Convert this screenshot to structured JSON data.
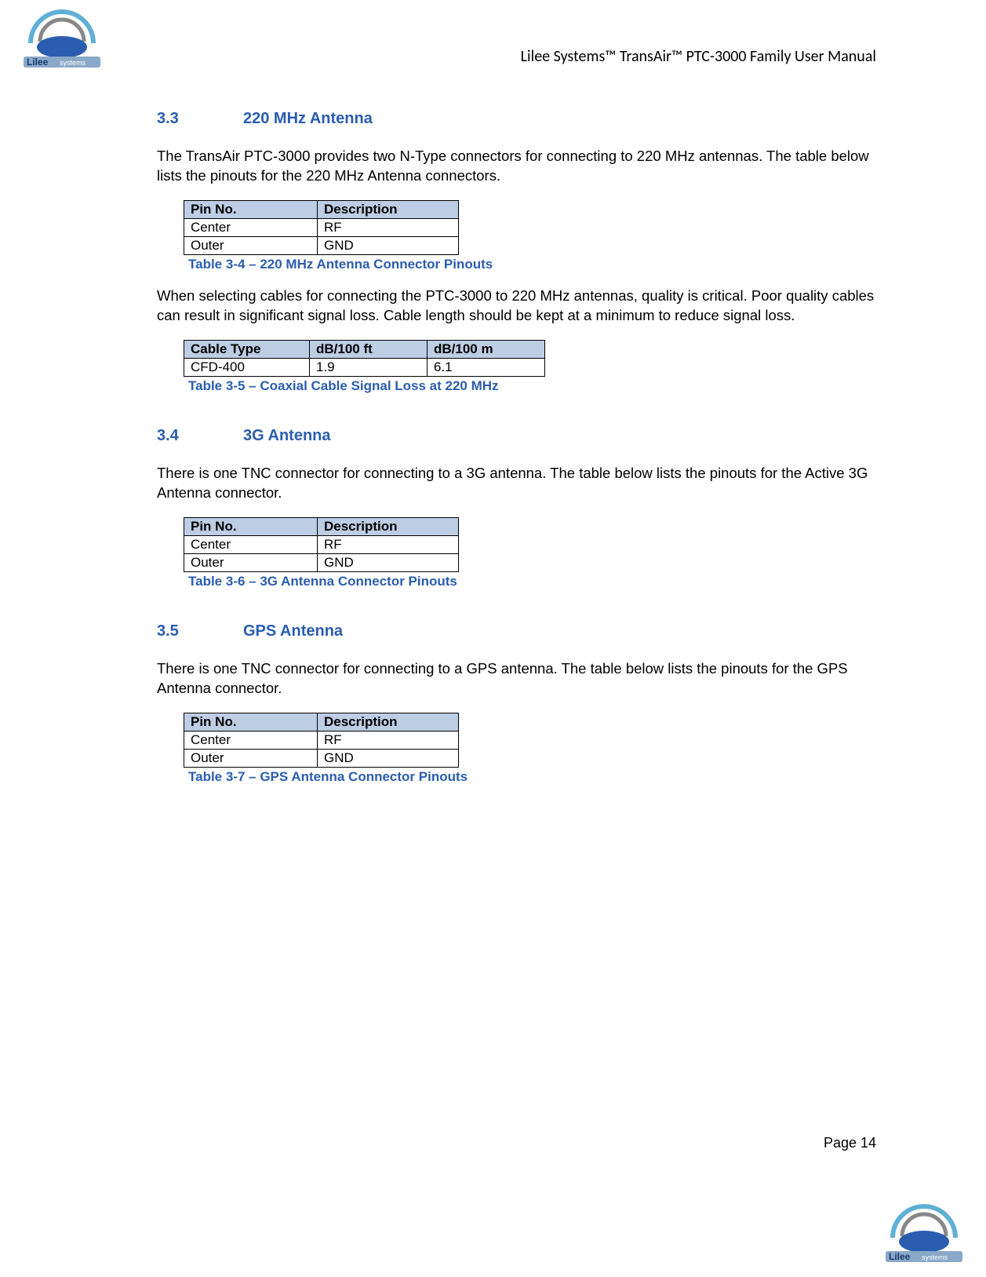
{
  "header": {
    "doc_title": "Lilee Systems™ TransAir™ PTC-3000 Family User Manual",
    "logo_text": "Lilee",
    "logo_sub": "systems"
  },
  "sections": [
    {
      "num": "3.3",
      "title": "220 MHz Antenna",
      "paras": [
        "The TransAir PTC-3000 provides two N-Type connectors for connecting to 220 MHz antennas. The table below lists the pinouts for the 220 MHz Antenna connectors."
      ],
      "table1": {
        "head": [
          "Pin No.",
          "Description"
        ],
        "rows": [
          [
            "Center",
            "RF"
          ],
          [
            "Outer",
            "GND"
          ]
        ],
        "caption": "Table 3-4  – 220 MHz Antenna Connector Pinouts"
      },
      "paras2": [
        "When selecting cables for connecting the PTC-3000 to 220 MHz antennas, quality is critical. Poor quality cables can result in significant signal loss. Cable length should be kept at a minimum to reduce signal loss."
      ],
      "table2": {
        "head": [
          "Cable Type",
          "dB/100 ft",
          "dB/100 m"
        ],
        "rows": [
          [
            "CFD-400",
            "1.9",
            "6.1"
          ]
        ],
        "caption": "Table 3-5  – Coaxial Cable Signal Loss at 220 MHz"
      }
    },
    {
      "num": "3.4",
      "title": "3G Antenna",
      "paras": [
        "There is one TNC connector for connecting to a 3G antenna. The table below lists the pinouts for the Active 3G Antenna connector."
      ],
      "table1": {
        "head": [
          "Pin No.",
          "Description"
        ],
        "rows": [
          [
            "Center",
            "RF"
          ],
          [
            "Outer",
            "GND"
          ]
        ],
        "caption": "Table 3-6  – 3G Antenna Connector Pinouts"
      }
    },
    {
      "num": "3.5",
      "title": "GPS Antenna",
      "paras": [
        "There is one TNC connector for connecting to a GPS antenna. The table below lists the pinouts for the GPS Antenna connector."
      ],
      "table1": {
        "head": [
          "Pin No.",
          "Description"
        ],
        "rows": [
          [
            "Center",
            "RF"
          ],
          [
            "Outer",
            "GND"
          ]
        ],
        "caption": "Table 3-7  – GPS Antenna Connector Pinouts"
      }
    }
  ],
  "footer": {
    "page": "Page 14"
  }
}
